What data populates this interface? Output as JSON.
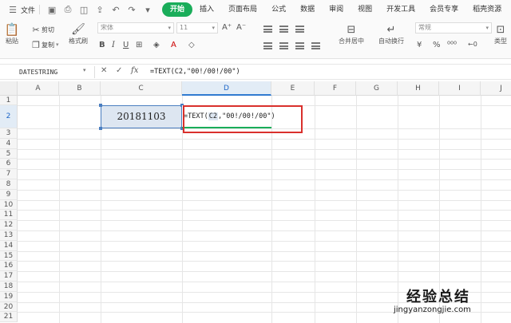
{
  "menubar": {
    "file_label": "文件",
    "tabs": [
      {
        "label": "开始",
        "active": true
      },
      {
        "label": "插入"
      },
      {
        "label": "页面布局"
      },
      {
        "label": "公式"
      },
      {
        "label": "数据"
      },
      {
        "label": "审阅"
      },
      {
        "label": "视图"
      },
      {
        "label": "开发工具"
      },
      {
        "label": "会员专享"
      },
      {
        "label": "稻壳资源"
      }
    ],
    "accent_color": "#1aad5a"
  },
  "ribbon": {
    "paste_label": "粘贴",
    "cut_label": "剪切",
    "copy_label": "复制",
    "format_painter_label": "格式刷",
    "font_name": "宋体",
    "font_size": "11",
    "merge_label": "合并居中",
    "wrap_label": "自动换行",
    "number_format": "常规",
    "type_label": "类型"
  },
  "formulabar": {
    "name_box": "DATESTRING",
    "fx_label": "fx",
    "formula": "=TEXT(C2,\"00!/00!/00\")"
  },
  "grid": {
    "columns": [
      "A",
      "B",
      "C",
      "D",
      "E",
      "F",
      "G",
      "H",
      "I",
      "J"
    ],
    "rows": [
      "1",
      "2",
      "3",
      "4",
      "5",
      "6",
      "7",
      "8",
      "9",
      "10",
      "11",
      "12",
      "13",
      "14",
      "15",
      "16",
      "17",
      "18",
      "19",
      "20",
      "21"
    ],
    "selected_column": "D",
    "selected_row": "2",
    "cells": {
      "C2": "20181103",
      "D2_prefix": "=TEXT(",
      "D2_ref": "C2",
      "D2_suffix": ",\"00!/00!/00\")"
    }
  },
  "watermark": {
    "brand": "经验总结",
    "url": "jingyanzongjie.com"
  }
}
